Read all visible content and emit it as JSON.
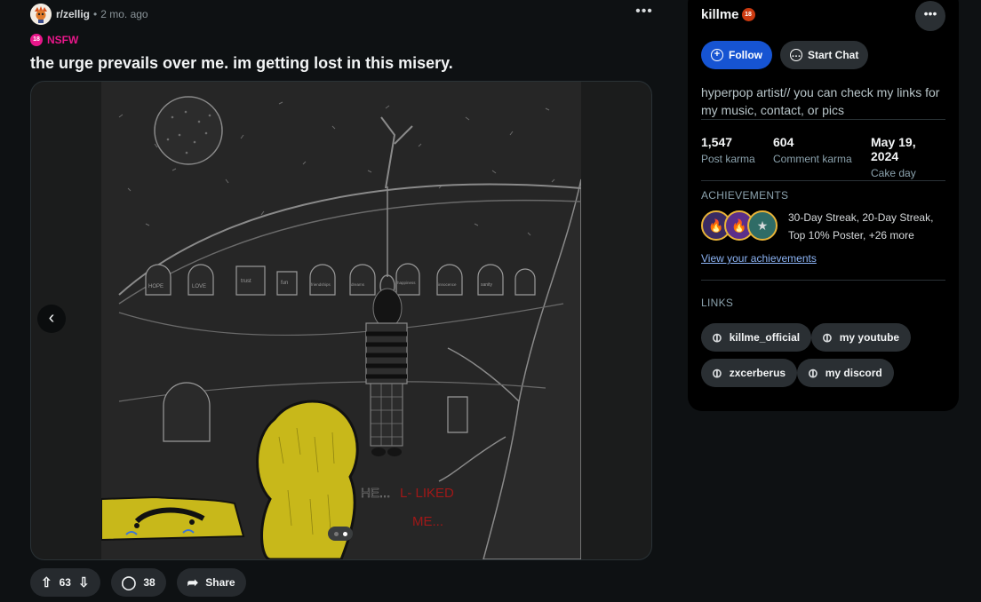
{
  "post": {
    "subreddit": "r/zellig",
    "separator": "•",
    "time_ago": "2 mo. ago",
    "nsfw_badge": "18",
    "nsfw_label": "NSFW",
    "title": "the urge prevails over me. im getting lost in this misery.",
    "image_text": {
      "headstones": [
        "HOPE",
        "LOVE",
        "trust",
        "fun",
        "friendships",
        "dreams",
        "happiness",
        "innocence",
        "sanity"
      ],
      "caption_he": "HE...",
      "caption_red": "L- LIKED",
      "caption_me": "ME..."
    },
    "carousel": {
      "pages": 2,
      "current": 2
    },
    "actions": {
      "votes": "63",
      "comments": "38",
      "share": "Share"
    }
  },
  "sidebar": {
    "username": "killme",
    "badge": "18",
    "follow": "Follow",
    "start_chat": "Start Chat",
    "bio": "hyperpop artist// you can check my links for my music, contact, or pics",
    "stats": [
      {
        "value": "1,547",
        "label": "Post karma"
      },
      {
        "value": "604",
        "label": "Comment karma"
      },
      {
        "value": "May 19, 2024",
        "label": "Cake day"
      }
    ],
    "achievements_title": "ACHIEVEMENTS",
    "achievements_text": "30-Day Streak, 20-Day Streak, Top 10% Poster, +26 more",
    "achievements_link": "View your achievements",
    "links_title": "LINKS",
    "links": [
      "killme_official",
      "my youtube",
      "zxcerberus",
      "my discord"
    ]
  },
  "colors": {
    "background": "#0e1113",
    "follow_button": "#1654d2",
    "nsfw": "#e8178a",
    "link": "#8cb4f5",
    "drawing_yellow": "#c8b81a",
    "drawing_red": "#a01818"
  }
}
